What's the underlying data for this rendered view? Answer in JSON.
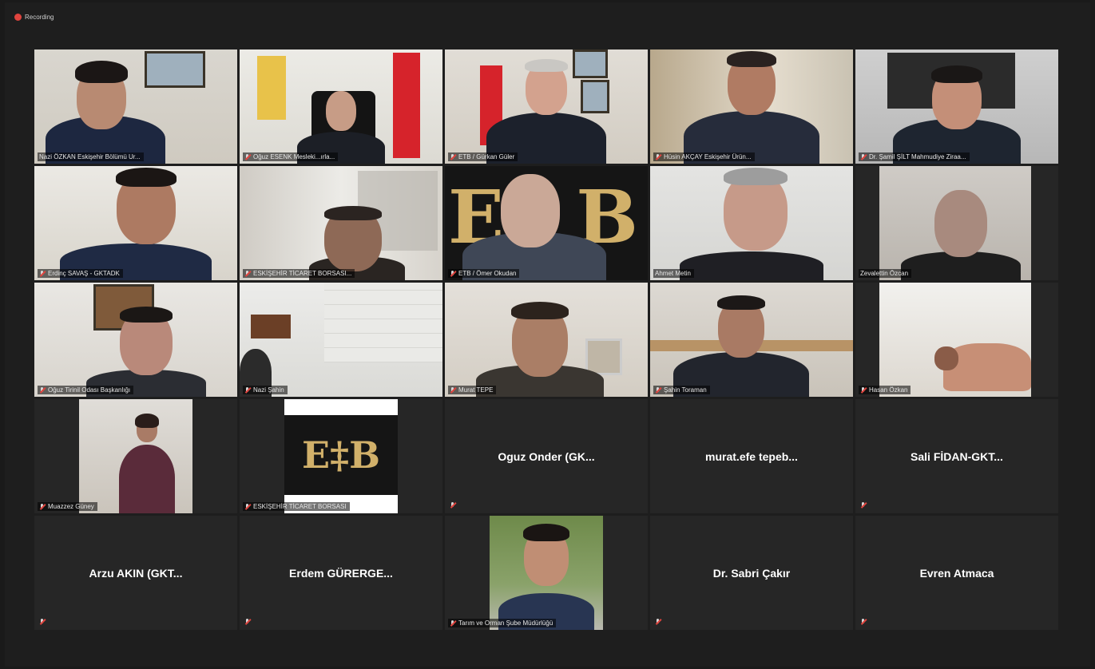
{
  "recording_label": "Recording",
  "colors": {
    "background": "#1e1e1e",
    "tile": "#262626",
    "active_speaker_border": "#c9d96a",
    "recording_dot": "#e0443e"
  },
  "participants": [
    {
      "name": "Nazi ÖZKAN Eskişehir Bölümü Ur...",
      "video": true,
      "speaking": true,
      "muted": false
    },
    {
      "name": "Oğuz ESENK Mesleki...ırla...",
      "video": true,
      "muted": true
    },
    {
      "name": "ETB / Gürkan Güler",
      "video": true,
      "muted": true
    },
    {
      "name": "Hüsin AKÇAY Eskişehir Ürün...",
      "video": true,
      "muted": true
    },
    {
      "name": "Dr. Şamil ŞİLT Mahmudiye Ziraa...",
      "video": true,
      "muted": true
    },
    {
      "name": "Erdinç SAVAŞ - GKTADK",
      "video": true,
      "muted": true
    },
    {
      "name": "ESKİŞEHİR TİCARET BORSASI...",
      "video": true,
      "muted": true
    },
    {
      "name": "ETB / Ömer Okudan",
      "video": true,
      "muted": true
    },
    {
      "name": "Ahmet Metin",
      "video": true,
      "muted": false
    },
    {
      "name": "Zevalettin Özcan",
      "video": true,
      "muted": false
    },
    {
      "name": "Oğuz Tirinil Odası Başkanlığı",
      "video": true,
      "muted": true
    },
    {
      "name": "Nazi Şahin",
      "video": true,
      "muted": true
    },
    {
      "name": "Murat TEPE",
      "video": true,
      "muted": true
    },
    {
      "name": "Şahin Toraman",
      "video": true,
      "muted": true
    },
    {
      "name": "Hasan Özkan",
      "video": true,
      "muted": true
    },
    {
      "name": "Muazzez Güney",
      "video": true,
      "muted": true
    },
    {
      "name": "ESKİŞEHİR TİCARET BORSASI",
      "video": true,
      "logo": "ETB",
      "muted": true
    },
    {
      "name": "Oguz Onder (GK...",
      "video": false,
      "muted": true
    },
    {
      "name": "murat.efe tepeb...",
      "video": false,
      "muted": false
    },
    {
      "name": "Sali FİDAN-GKT...",
      "video": false,
      "muted": true
    },
    {
      "name": "Arzu AKIN (GKT...",
      "video": false,
      "muted": true
    },
    {
      "name": "Erdem GÜRERGE...",
      "video": false,
      "muted": true
    },
    {
      "name": "Tarım ve Orman Şube Müdürlüğü",
      "video": true,
      "muted": true
    },
    {
      "name": "Dr. Sabri Çakır",
      "video": false,
      "muted": true
    },
    {
      "name": "Evren Atmaca",
      "video": false,
      "muted": true
    }
  ]
}
